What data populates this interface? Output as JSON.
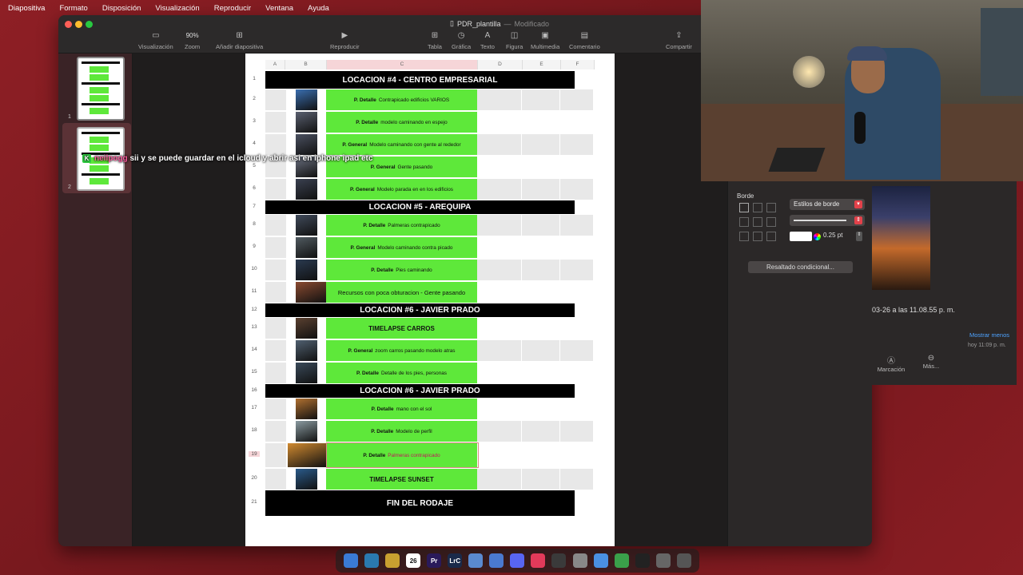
{
  "menubar": [
    "Diapositiva",
    "Formato",
    "Disposición",
    "Visualización",
    "Reproducir",
    "Ventana",
    "Ayuda"
  ],
  "window": {
    "doc_name": "PDR_plantilla",
    "doc_status": "Modificado",
    "toolbar": [
      {
        "icon": "sidebar-icon",
        "label": "Visualización"
      },
      {
        "icon": "zoom-value",
        "label": "Zoom",
        "value": "90%"
      },
      {
        "icon": "add-slide-icon",
        "label": "Añadir diapositiva"
      },
      {
        "icon": "play-icon",
        "label": "Reproducir"
      },
      {
        "icon": "table-icon",
        "label": "Tabla"
      },
      {
        "icon": "chart-icon",
        "label": "Gráfica"
      },
      {
        "icon": "text-icon",
        "label": "Texto"
      },
      {
        "icon": "shape-icon",
        "label": "Figura"
      },
      {
        "icon": "media-icon",
        "label": "Multimedia"
      },
      {
        "icon": "comment-icon",
        "label": "Comentario"
      },
      {
        "icon": "share-icon",
        "label": "Compartir"
      }
    ]
  },
  "slides": [
    "1",
    "2"
  ],
  "sheet": {
    "columns": [
      "A",
      "B",
      "C",
      "D",
      "E",
      "F"
    ],
    "rows": [
      {
        "n": "1",
        "type": "header",
        "text": "LOCACION #4 - CENTRO EMPRESARIAL"
      },
      {
        "n": "2",
        "type": "shot",
        "bold": "P. Detalle",
        "text": "Contrapicado edificios VARIOS"
      },
      {
        "n": "3",
        "type": "shot",
        "bold": "P. Detalle",
        "text": "modelo caminando en espejo"
      },
      {
        "n": "4",
        "type": "shot",
        "bold": "P. General",
        "text": "Modelo caminando con gente al rededor"
      },
      {
        "n": "5",
        "type": "shot",
        "bold": "P. General",
        "text": "Gente pasando"
      },
      {
        "n": "6",
        "type": "shot",
        "bold": "P. General",
        "text": "Modelo parada en en los edificios"
      },
      {
        "n": "7",
        "type": "header",
        "text": "LOCACION #5 - AREQUIPA"
      },
      {
        "n": "8",
        "type": "shot",
        "bold": "P. Detalle",
        "text": "Palmeras contrapicado"
      },
      {
        "n": "9",
        "type": "shot",
        "bold": "P. General",
        "text": "Modelo caminando contra picado"
      },
      {
        "n": "10",
        "type": "shot",
        "bold": "P. Detalle",
        "text": "Pies caminando"
      },
      {
        "n": "11",
        "type": "shot",
        "bold": "",
        "text": "Recursos con poca obturacion - Gente pasando"
      },
      {
        "n": "12",
        "type": "header",
        "text": "LOCACION #6 - JAVIER PRADO"
      },
      {
        "n": "13",
        "type": "big",
        "text": "TIMELAPSE CARROS"
      },
      {
        "n": "14",
        "type": "shot",
        "bold": "P. General",
        "text": "zoom carros pasando modelo atras"
      },
      {
        "n": "15",
        "type": "shot",
        "bold": "P. Detalle",
        "text": "Detalle de los pies, personas"
      },
      {
        "n": "16",
        "type": "header",
        "text": "LOCACION #6 - JAVIER PRADO"
      },
      {
        "n": "17",
        "type": "shot",
        "bold": "P. Detalle",
        "text": "mano con el sol"
      },
      {
        "n": "18",
        "type": "shot",
        "bold": "P. Detalle",
        "text": "Modelo de perfil"
      },
      {
        "n": "19",
        "type": "shot",
        "bold": "P. Detalle",
        "text": "Palmeras contrapicado"
      },
      {
        "n": "20",
        "type": "big",
        "text": "TIMELAPSE SUNSET"
      },
      {
        "n": "21",
        "type": "fin",
        "text": "FIN DEL RODAJE"
      }
    ]
  },
  "inspector": {
    "border_label": "Borde",
    "border_style": "Estilos de borde",
    "border_width": "0.25 pt",
    "conditional_button": "Resaltado condicional..."
  },
  "photo_panel": {
    "date_text": "03-26 a las 11.08.55 p. m.",
    "show_less": "Mostrar menos",
    "today": "hoy 11:09 p. m.",
    "mark_label": "Marcación",
    "more_label": "Más..."
  },
  "chat": {
    "user": "neilpogg",
    "message": "sii y se puede guardar en el icloud y abrir asi en iphone ipad etc"
  },
  "dock": [
    "Finder",
    "Safari",
    "Notes",
    "26",
    "Pr",
    "LrC",
    "App",
    "Keynote",
    "Discord",
    "Music",
    "Activity",
    "Disk",
    "Chrome",
    "Maps",
    "Terminal",
    "Utility",
    "Trash"
  ],
  "colors": {
    "green": "#5ee83a",
    "header_black": "#000000",
    "accent_red": "#e2414a"
  }
}
